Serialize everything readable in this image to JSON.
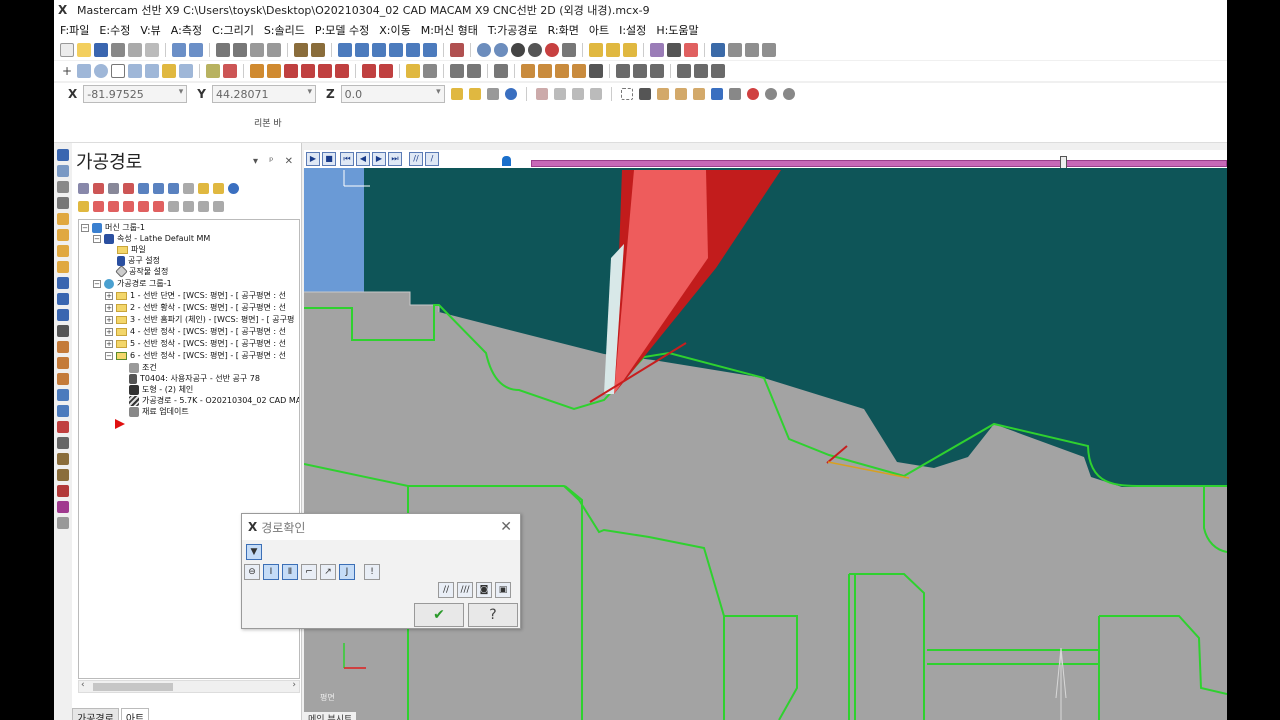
{
  "window": {
    "title": "Mastercam 선반 X9  C:\\Users\\toysk\\Desktop\\O20210304_02 CAD MACAM X9 CNC선반 2D (외경 내경).mcx-9"
  },
  "menu": [
    "F:파일",
    "E:수정",
    "V:뷰",
    "A:측정",
    "C:그리기",
    "S:솔리드",
    "P:모델 수정",
    "X:이동",
    "M:머신 형태",
    "T:가공경로",
    "R:화면",
    "아트",
    "I:설정",
    "H:도움말"
  ],
  "coords": {
    "x_label": "X",
    "x_value": "-81.97525",
    "y_label": "Y",
    "y_value": "44.28071",
    "z_label": "Z",
    "z_value": "0.0"
  },
  "ribbon_label": "리본 바",
  "panel": {
    "title": "가공경로",
    "controls": "▾ ᵖ ✕",
    "tabs": [
      "가공경로",
      "아트"
    ],
    "tree": [
      "머신 그룹-1",
      "속성 - Lathe Default MM",
      "파일",
      "공구 설정",
      "공작물 설정",
      "가공경로 그룹-1",
      "1 - 선반 단면 - [WCS: 평면] - [ 공구평면 : 선",
      "2 - 선반 황삭 - [WCS: 평면] - [ 공구평면 : 선",
      "3 - 선반 홈파기 (체인) - [WCS: 평면] - [ 공구평",
      "4 - 선반 정삭 - [WCS: 평면] - [ 공구평면 : 선",
      "5 - 선반 정삭 - [WCS: 평면] - [ 공구평면 : 선",
      "6 - 선반 정삭 - [WCS: 평면] - [ 공구평면 : 선",
      "조건",
      "T0404: 사용자공구 - 선반 공구 78",
      "도형 - (2) 체인",
      "가공경로 - 5.7K - O20210304_02 CAD MAC",
      "재료 업데이트"
    ]
  },
  "viewport": {
    "plane_label": "평면",
    "bottom_tab": "메인 뷰시트",
    "colors": {
      "background": "#0e5558",
      "stock": "#9a9a9a",
      "geometry": "#2fd12f",
      "tool_insert": "#ee5c5c",
      "tool_holder": "#c21c1c"
    }
  },
  "dialog": {
    "title": "경로확인",
    "close": "✕",
    "ok": "✔",
    "help": "?"
  }
}
